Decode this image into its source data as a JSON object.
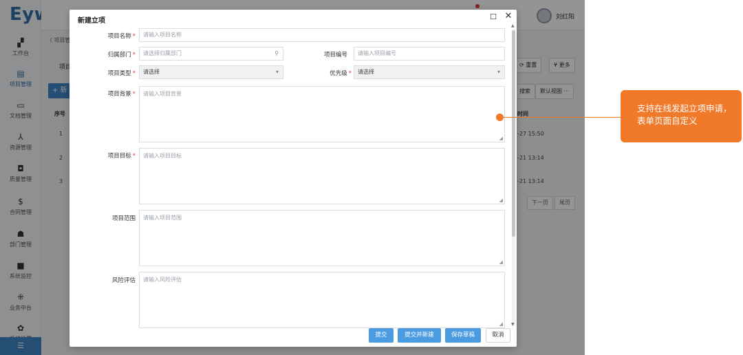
{
  "app": {
    "logo": "Eywe",
    "user_name": "刘红阳"
  },
  "sidebar": {
    "items": [
      {
        "label": "工作台",
        "icon": "workbench-icon",
        "glyph": "▞"
      },
      {
        "label": "项目管理",
        "icon": "project-icon",
        "glyph": "▤"
      },
      {
        "label": "文档管理",
        "icon": "document-icon",
        "glyph": "▭"
      },
      {
        "label": "资源管理",
        "icon": "resource-icon",
        "glyph": "⅄"
      },
      {
        "label": "质量管理",
        "icon": "quality-icon",
        "glyph": "◘"
      },
      {
        "label": "合同管理",
        "icon": "contract-icon",
        "glyph": "$"
      },
      {
        "label": "部门管理",
        "icon": "department-icon",
        "glyph": "☗"
      },
      {
        "label": "系统监控",
        "icon": "monitor-icon",
        "glyph": "■"
      },
      {
        "label": "业务中台",
        "icon": "business-icon",
        "glyph": "⁜"
      },
      {
        "label": "系统设置",
        "icon": "settings-icon",
        "glyph": "✿"
      }
    ],
    "bottom_glyph": "☰"
  },
  "background": {
    "breadcrumb": "〈 项目管",
    "section_label": "项目",
    "reset_label": "重置",
    "more_label": "更多",
    "new_label": "+ 新",
    "view_label": "默认视图 ···",
    "table_header_index": "序号",
    "table_header_time": "时间",
    "rows": [
      {
        "index": "1",
        "time": "-27 15:50"
      },
      {
        "index": "2",
        "time": "-21 13:14"
      },
      {
        "index": "3",
        "time": "-21 13:14"
      }
    ],
    "pager_next": "下一页",
    "pager_last": "尾页"
  },
  "dialog": {
    "title": "新建立项",
    "fields": {
      "name": {
        "label": "项目名称",
        "placeholder": "请输入项目名称",
        "required": true
      },
      "department": {
        "label": "归属部门",
        "placeholder": "请选择归属部门",
        "required": true
      },
      "code": {
        "label": "项目编号",
        "placeholder": "请输入项目编号",
        "required": false
      },
      "type": {
        "label": "项目类型",
        "value": "请选择",
        "required": true
      },
      "priority": {
        "label": "优先级",
        "value": "请选择",
        "required": true
      },
      "background": {
        "label": "项目背景",
        "placeholder": "请输入项目背景",
        "required": true
      },
      "goal": {
        "label": "项目目标",
        "placeholder": "请输入项目目标",
        "required": true
      },
      "scope": {
        "label": "项目范围",
        "placeholder": "请输入项目范围",
        "required": false
      },
      "risk": {
        "label": "风险评估",
        "placeholder": "请输入风险评估",
        "required": false
      }
    },
    "buttons": {
      "submit": "提交",
      "submit_new": "提交并新建",
      "save_draft": "保存草稿",
      "cancel": "取消"
    }
  },
  "callout": {
    "text": "支持在线发起立项申请，表单页面自定义"
  },
  "colors": {
    "primary": "#4a9be0",
    "callout": "#f07a2a",
    "required": "#e23c3c"
  }
}
